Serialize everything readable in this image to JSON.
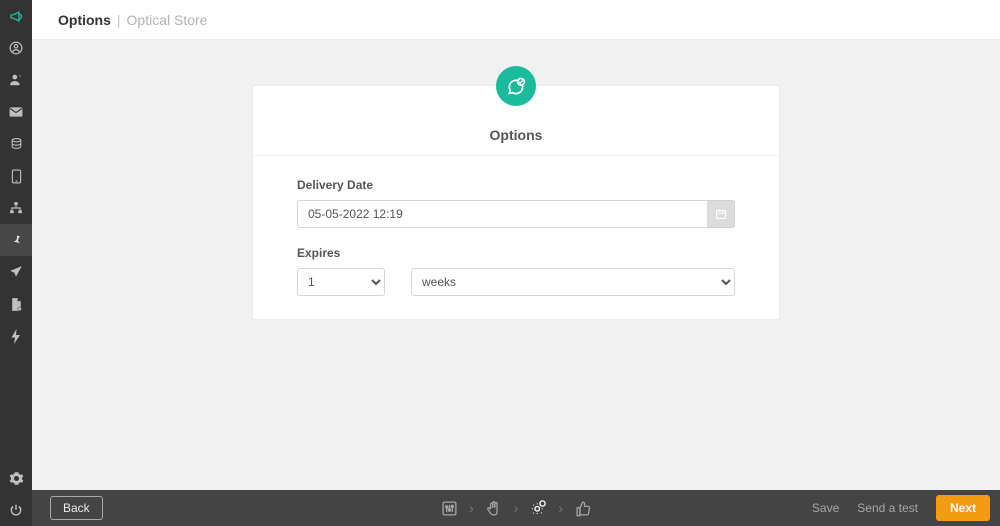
{
  "header": {
    "title": "Options",
    "sub": "Optical Store"
  },
  "card": {
    "title": "Options",
    "delivery_label": "Delivery Date",
    "delivery_value": "05-05-2022 12:19",
    "expires_label": "Expires",
    "expires_number": "1",
    "expires_unit": "weeks"
  },
  "footer": {
    "back": "Back",
    "save": "Save",
    "send_test": "Send a test",
    "next": "Next"
  },
  "colors": {
    "accent": "#1abc9c",
    "primary_button": "#f39c12"
  }
}
